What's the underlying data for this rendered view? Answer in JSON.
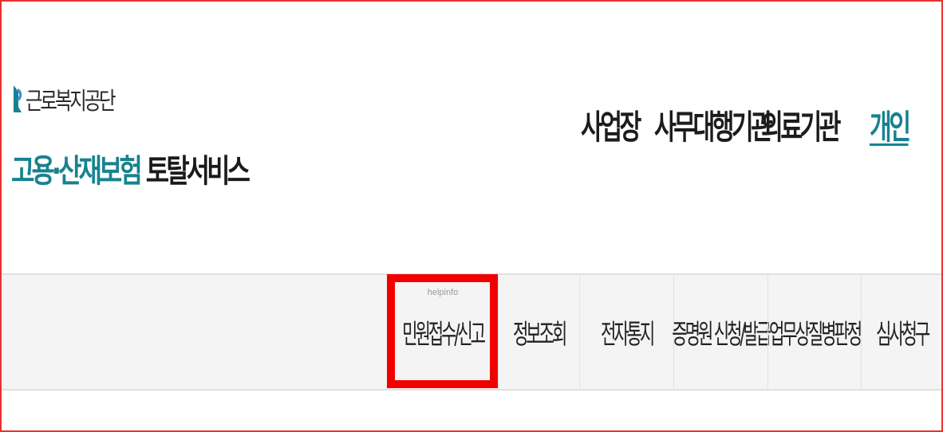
{
  "logo": {
    "org_name": "근로복지공단",
    "service_part1": "고용·산재보험",
    "service_part2": "토탈서비스"
  },
  "top_nav": [
    {
      "label": "사업장",
      "active": false
    },
    {
      "label": "사무대행기관",
      "active": false
    },
    {
      "label": "의료기관",
      "active": false
    },
    {
      "label": "개인",
      "active": true
    }
  ],
  "menu": {
    "items": [
      {
        "label": "민원접수/신고",
        "sublabel": "helpinfo",
        "highlighted": true
      },
      {
        "label": "정보조회"
      },
      {
        "label": "전자통지"
      },
      {
        "label": "증명원 신청/발급"
      },
      {
        "label": "업무상질병판정"
      },
      {
        "label": "심사청구"
      }
    ]
  },
  "colors": {
    "accent_teal": "#17828f",
    "highlight_red": "#f20000",
    "frame_border": "#e8322f",
    "menu_bg": "#f4f4f4"
  }
}
